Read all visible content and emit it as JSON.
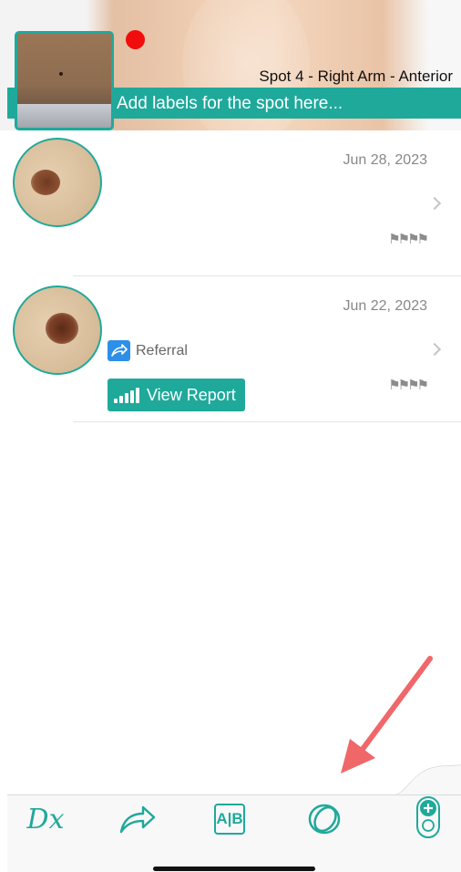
{
  "header": {
    "spot_title": "Spot 4 - Right Arm - Anterior",
    "label_placeholder": "Add labels for the spot here...",
    "accent_color": "#1fa99b",
    "marker_color": "#f20d0d"
  },
  "entries": [
    {
      "date": "Jun 28, 2023",
      "flags": "⚑⚑⚑⚑"
    },
    {
      "date": "Jun 22, 2023",
      "referral_label": "Referral",
      "view_report_label": "View Report",
      "flags": "⚑⚑⚑⚑"
    }
  ],
  "tabbar": {
    "items": [
      {
        "icon": "dx-icon",
        "glyph": "Dx"
      },
      {
        "icon": "share-arrow-icon"
      },
      {
        "icon": "compare-ab-icon",
        "glyph": "A|B"
      },
      {
        "icon": "overlap-rings-icon"
      },
      {
        "icon": "add-device-icon"
      }
    ]
  },
  "annotation": {
    "icon": "red-arrow-icon",
    "color": "#f0676a"
  }
}
